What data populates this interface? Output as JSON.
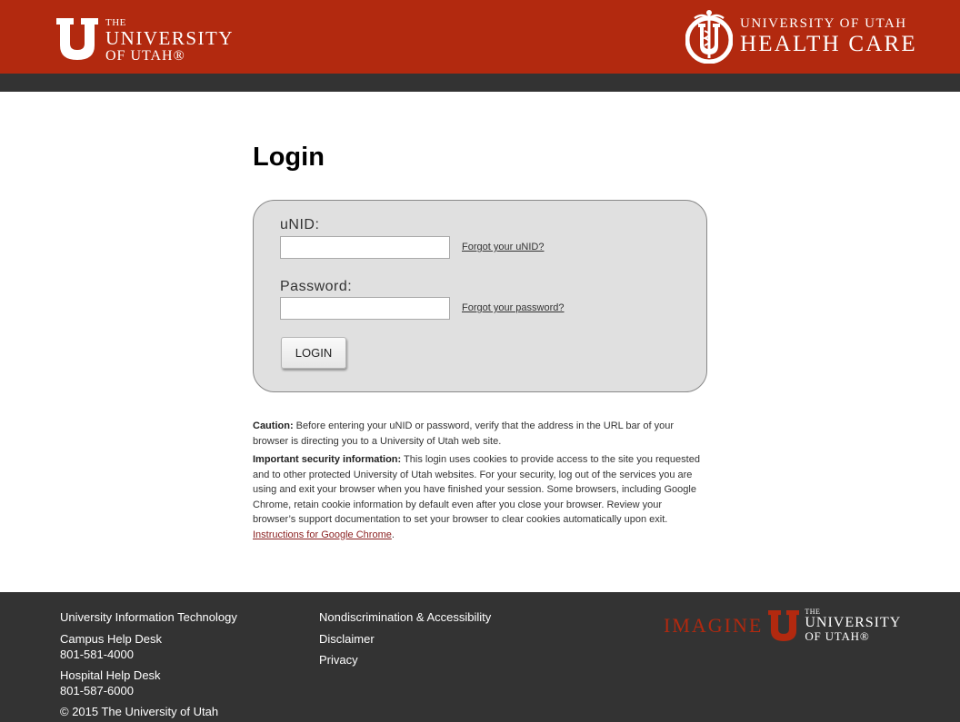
{
  "header": {
    "university_logo": {
      "the": "THE",
      "university": "UNIVERSITY",
      "of_utah": "OF UTAH®"
    },
    "health_care_logo": {
      "line1": "UNIVERSITY OF UTAH",
      "line2": "HEALTH CARE"
    },
    "colors": {
      "brand_red": "#b2290f",
      "dark_strip": "#333333"
    }
  },
  "main": {
    "title": "Login",
    "form": {
      "unid_label": "uNID:",
      "unid_value": "",
      "forgot_unid": "Forgot your uNID?",
      "password_label": "Password:",
      "password_value": "",
      "forgot_password": "Forgot your password?",
      "login_button": "LOGIN"
    },
    "caution": {
      "label": "Caution:",
      "text": " Before entering your uNID or password, verify that the address in the URL bar of your browser is directing you to a University of Utah web site."
    },
    "security": {
      "label": "Important security information:",
      "text": " This login uses cookies to provide access to the site you requested and to other protected University of Utah websites. For your security, log out of the services you are using and exit your browser when you have finished your session. Some browsers, including Google Chrome, retain cookie information by default even after you close your browser. Review your browser’s support documentation to set your browser to clear cookies automatically upon exit. ",
      "link": "Instructions for Google Chrome",
      "end": "."
    }
  },
  "footer": {
    "uit": "University Information Technology",
    "campus_help_desk": "Campus Help Desk",
    "campus_phone": "801-581-4000",
    "hospital_help_desk": "Hospital Help Desk",
    "hospital_phone": "801-587-6000",
    "copyright": "© 2015 The University of Utah",
    "nondiscrimination": "Nondiscrimination & Accessibility",
    "disclaimer": "Disclaimer",
    "privacy": "Privacy",
    "imagine_logo": {
      "imagine": "IMAGINE",
      "the": "THE",
      "university": "UNIVERSITY",
      "of_utah": "OF UTAH®"
    }
  }
}
